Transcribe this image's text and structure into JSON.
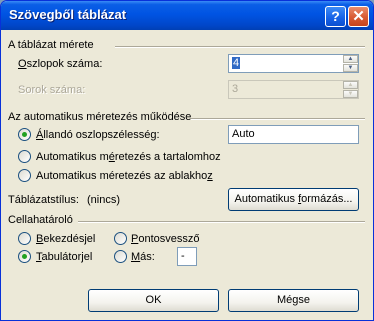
{
  "window": {
    "title": "Szövegből táblázat",
    "help_glyph": "?",
    "close_glyph": "✕"
  },
  "table_size": {
    "group_label": "A táblázat mérete",
    "columns_label_pre": "",
    "columns_label_key": "O",
    "columns_label_post": "szlopok száma:",
    "columns_value": "4",
    "rows_label": "Sorok száma:",
    "rows_value": "3"
  },
  "autofit": {
    "group_label": "Az automatikus méretezés működése",
    "fixed_label_pre": "",
    "fixed_label_key": "Á",
    "fixed_label_post": "llandó oszlopszélesség:",
    "fixed_selected": true,
    "fixed_value": "Auto",
    "contents_label_pre": "Automatikus m",
    "contents_label_key": "é",
    "contents_label_post": "retezés a tartalomhoz",
    "window_label_pre": "Automatikus méretezés az ablakho",
    "window_label_key": "z",
    "window_label_post": ""
  },
  "table_style": {
    "label": "Táblázatstílus:",
    "value": "(nincs)",
    "button_pre": "Automatikus ",
    "button_key": "f",
    "button_post": "ormázás..."
  },
  "separator": {
    "group_label": "Cellahatároló",
    "paragraph_pre": "",
    "paragraph_key": "B",
    "paragraph_post": "ekezdésjel",
    "semicolon_pre": "",
    "semicolon_key": "P",
    "semicolon_post": "ontosvessző",
    "tab_pre": "",
    "tab_key": "T",
    "tab_post": "abulátorjel",
    "tab_selected": true,
    "other_pre": "",
    "other_key": "M",
    "other_post": "ás:",
    "other_value": "-"
  },
  "buttons": {
    "ok": "OK",
    "cancel": "Mégse"
  },
  "icons": {
    "up_arrow": "▲",
    "down_arrow": "▼"
  }
}
